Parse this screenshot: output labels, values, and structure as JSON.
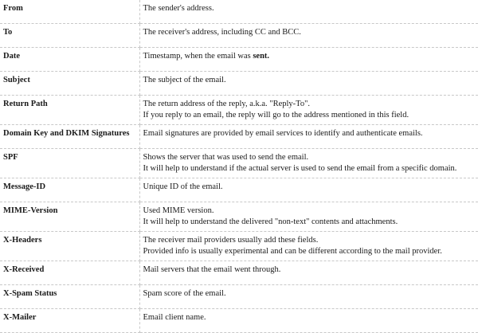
{
  "rows": [
    {
      "field": "From",
      "lines": [
        "The sender's address."
      ]
    },
    {
      "field": "To",
      "lines": [
        "The receiver's address, including CC and BCC."
      ]
    },
    {
      "field": "Date",
      "lines": [
        "Timestamp, when the email was "
      ],
      "emphasis": "sent."
    },
    {
      "field": "Subject",
      "lines": [
        "The subject of the email."
      ]
    },
    {
      "field": "Return Path",
      "lines": [
        "The return address of the reply, a.k.a. \"Reply-To\".",
        "If you reply to an email, the reply will go to the address mentioned in this field."
      ]
    },
    {
      "field": "Domain Key and DKIM Signatures",
      "lines": [
        "Email signatures are provided by email services to identify and authenticate emails."
      ]
    },
    {
      "field": "SPF",
      "lines": [
        "Shows the server that was used to send the email.",
        "It will help to understand if the actual server is used to send the email from a specific domain."
      ]
    },
    {
      "field": "Message-ID",
      "lines": [
        "Unique ID of the email."
      ]
    },
    {
      "field": "MIME-Version",
      "lines": [
        "Used MIME version.",
        "It will help to understand the delivered \"non-text\" contents and attachments."
      ]
    },
    {
      "field": "X-Headers",
      "lines": [
        "The receiver mail providers usually add these fields.",
        "Provided info is usually experimental and can be different according to the mail provider."
      ]
    },
    {
      "field": "X-Received",
      "lines": [
        "Mail servers that the email went through."
      ]
    },
    {
      "field": "X-Spam Status",
      "lines": [
        "Spam score of the email."
      ]
    },
    {
      "field": "X-Mailer",
      "lines": [
        "Email client name."
      ]
    }
  ]
}
